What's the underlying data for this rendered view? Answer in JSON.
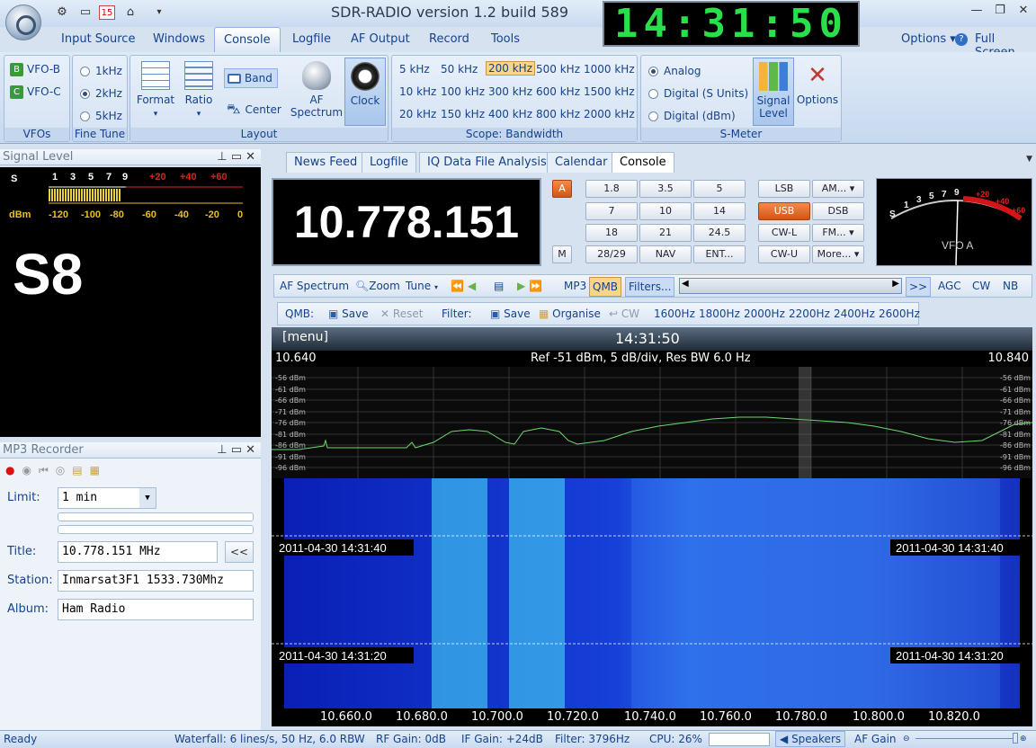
{
  "app": {
    "title": "SDR-RADIO version 1.2  build 589",
    "clock": "14:31:50"
  },
  "menu": {
    "items": [
      "Input Source",
      "Windows",
      "Console",
      "Logfile",
      "AF Output",
      "Record",
      "Tools"
    ],
    "options": "Options",
    "full_screen": "Full Screen"
  },
  "ribbon": {
    "vfos": {
      "b": "VFO-B",
      "c": "VFO-C",
      "label": "VFOs"
    },
    "fine_tune": {
      "options": [
        "1kHz",
        "2kHz",
        "5kHz"
      ],
      "selected": "2kHz",
      "label": "Fine Tune"
    },
    "layout": {
      "format": "Format",
      "ratio": "Ratio",
      "band": "Band",
      "center": "Center",
      "af_spectrum": "AF\nSpectrum",
      "clock": "Clock",
      "label": "Layout"
    },
    "bandwidth": {
      "items": [
        "5 kHz",
        "50 kHz",
        "200 kHz",
        "500 kHz",
        "1000 kHz",
        "10 kHz",
        "100 kHz",
        "300 kHz",
        "600 kHz",
        "1500 kHz",
        "20 kHz",
        "150 kHz",
        "400 kHz",
        "800 kHz",
        "2000 kHz"
      ],
      "selected": "200 kHz",
      "label": "Scope: Bandwidth"
    },
    "smeter": {
      "options": [
        "Analog",
        "Digital (S Units)",
        "Digital (dBm)"
      ],
      "selected": "Analog",
      "signal_level": "Signal\nLevel",
      "options_btn": "Options",
      "label": "S-Meter"
    }
  },
  "signal_panel": {
    "title": "Signal Level",
    "s_value": "S8",
    "scale_top": [
      "S",
      "1",
      "3",
      "5",
      "7",
      "9",
      "+20",
      "+40",
      "+60"
    ],
    "scale_bottom": [
      "dBm",
      "-120",
      "-100",
      "-80",
      "-60",
      "-40",
      "-20",
      "0"
    ]
  },
  "mp3": {
    "title": "MP3 Recorder",
    "limit_label": "Limit:",
    "limit_value": "1 min",
    "title_label": "Title:",
    "title_value": "10.778.151 MHz",
    "back_btn": "<<",
    "station_label": "Station:",
    "station_value": "Inmarsat3F1 1533.730Mhz",
    "album_label": "Album:",
    "album_value": "Ham Radio"
  },
  "tabs": [
    "News Feed",
    "Logfile",
    "IQ Data File Analysis",
    "Calendar",
    "Console"
  ],
  "active_tab": "Console",
  "console": {
    "frequency": "10.778.151",
    "a_btn": "A",
    "m_btn": "M",
    "bands": [
      "1.8",
      "3.5",
      "5",
      "7",
      "10",
      "14",
      "18",
      "21",
      "24.5",
      "28/29",
      "NAV",
      "ENT..."
    ],
    "modes": [
      "LSB",
      "AM...",
      "USB",
      "DSB",
      "CW-L",
      "FM...",
      "CW-U",
      "More..."
    ],
    "active_mode": "USB",
    "vfo_label": "VFO A",
    "smeter_scale": [
      "S",
      "1",
      "3",
      "5",
      "7",
      "9",
      "+20",
      "+40",
      "+60"
    ]
  },
  "toolbar1": {
    "af_spectrum": "AF Spectrum",
    "zoom": "Zoom",
    "tune": "Tune",
    "mp3": "MP3",
    "qmb": "QMB",
    "filters": "Filters...",
    "more": ">>",
    "agc": "AGC",
    "cw": "CW",
    "nb": "NB"
  },
  "toolbar2": {
    "qmb": "QMB:",
    "save": "Save",
    "reset": "Reset",
    "filter": "Filter:",
    "save2": "Save",
    "organise": "Organise",
    "cw": "CW",
    "presets": [
      "1600Hz",
      "1800Hz",
      "2000Hz",
      "2200Hz",
      "2400Hz",
      "2600Hz"
    ]
  },
  "spectrum": {
    "menu": "[menu]",
    "time": "14:31:50",
    "start": "10.640",
    "end": "10.840",
    "info": "Ref -51 dBm,  5 dB/div,  Res BW 6.0 Hz",
    "db_labels": [
      "-56 dBm",
      "-61 dBm",
      "-66 dBm",
      "-71 dBm",
      "-76 dBm",
      "-81 dBm",
      "-86 dBm",
      "-91 dBm",
      "-96 dBm"
    ],
    "stamp1": "2011-04-30  14:31:40",
    "stamp2": "2011-04-30  14:31:20",
    "freq_axis": [
      "10.660.0",
      "10.680.0",
      "10.700.0",
      "10.720.0",
      "10.740.0",
      "10.760.0",
      "10.780.0",
      "10.800.0",
      "10.820.0"
    ]
  },
  "status": {
    "ready": "Ready",
    "waterfall": "Waterfall: 6 lines/s, 50 Hz, 6.0 RBW",
    "rf_gain": "RF Gain: 0dB",
    "if_gain": "IF Gain: +24dB",
    "filter": "Filter: 3796Hz",
    "cpu": "CPU: 26%",
    "speakers": "Speakers",
    "af_gain": "AF Gain"
  }
}
